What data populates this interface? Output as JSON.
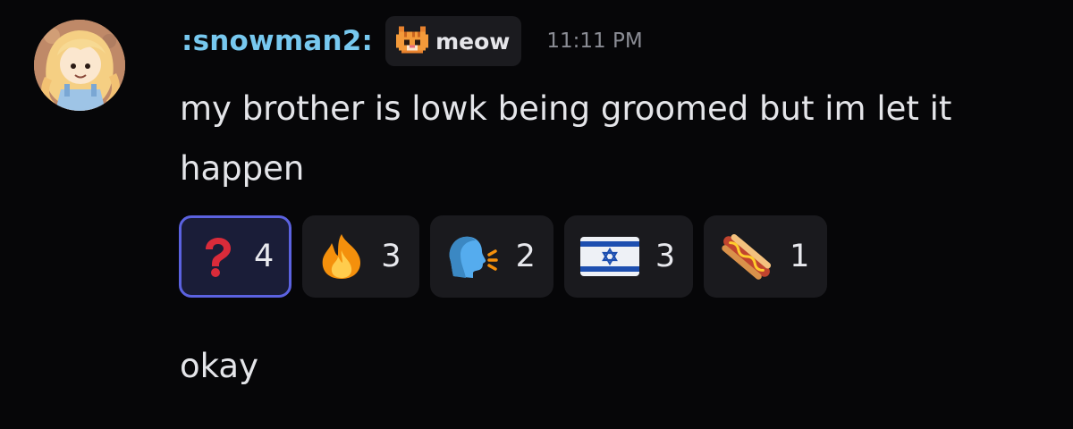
{
  "message": {
    "author": ":snowman2:",
    "tag": {
      "icon": "orange-cat-pixel-icon",
      "label": "meow"
    },
    "timestamp": "11:11 PM",
    "content": "my brother is lowk being groomed but im let it happen",
    "reactions": [
      {
        "emoji": "question-mark-icon",
        "count": "4",
        "active": true
      },
      {
        "emoji": "fire-icon",
        "count": "3",
        "active": false
      },
      {
        "emoji": "speaking-head-icon",
        "count": "2",
        "active": false
      },
      {
        "emoji": "israel-flag-icon",
        "count": "3",
        "active": false
      },
      {
        "emoji": "hot-dog-icon",
        "count": "1",
        "active": false
      }
    ]
  },
  "next_message": {
    "content": "okay"
  },
  "colors": {
    "background": "#060608",
    "username": "#77c8ef",
    "active_reaction_border": "#5b62e0",
    "reaction_bg": "#1a1a1e"
  }
}
